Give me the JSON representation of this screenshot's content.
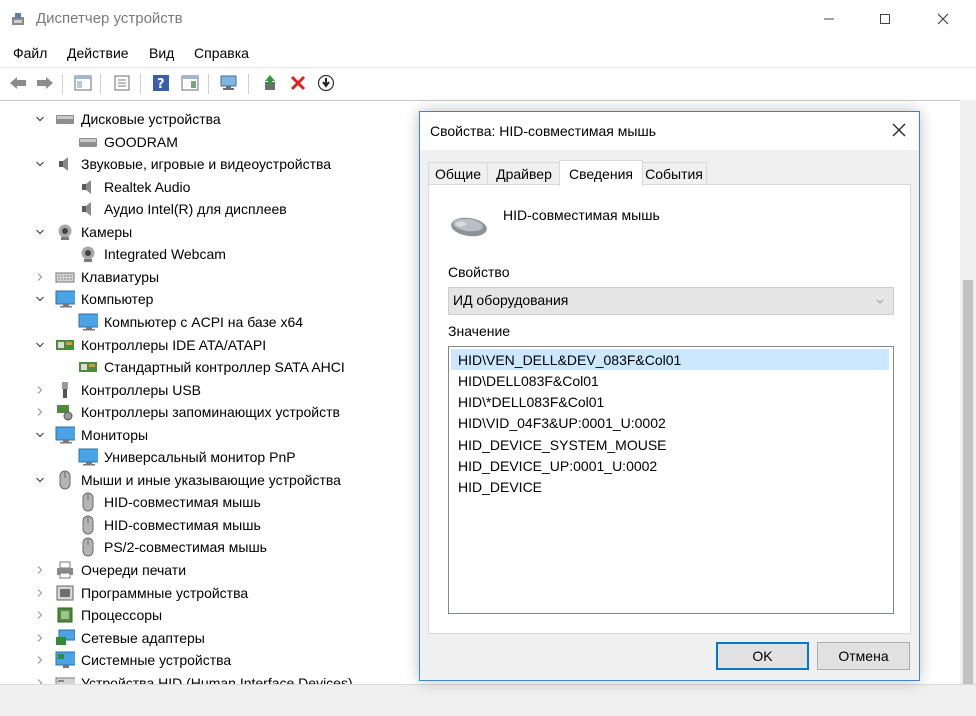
{
  "app": {
    "title": "Диспетчер устройств",
    "minimize_icon": "minimize-icon",
    "maximize_icon": "maximize-icon",
    "close_icon": "close-icon"
  },
  "menu": [
    "Файл",
    "Действие",
    "Вид",
    "Справка"
  ],
  "toolbar": {
    "buttons": [
      "back-arrow-icon",
      "forward-arrow-icon",
      "show-hide-console-tree-icon",
      "properties-icon",
      "help-icon",
      "action-pane-icon",
      "scan-hardware-icon",
      "update-driver-icon",
      "uninstall-device-icon",
      "disable-device-icon"
    ]
  },
  "tree": [
    {
      "label": "Дисковые устройства",
      "expanded": true,
      "icon": "disk-drive-icon"
    },
    {
      "label": "GOODRAM",
      "icon": "disk-drive-icon"
    },
    {
      "label": "Звуковые, игровые и видеоустройства",
      "expanded": true,
      "icon": "speaker-icon"
    },
    {
      "label": "Realtek Audio",
      "icon": "speaker-icon"
    },
    {
      "label": "Аудио Intel(R) для дисплеев",
      "icon": "speaker-icon"
    },
    {
      "label": "Камеры",
      "expanded": true,
      "icon": "webcam-icon"
    },
    {
      "label": "Integrated Webcam",
      "icon": "webcam-icon"
    },
    {
      "label": "Клавиатуры",
      "expanded": false,
      "icon": "keyboard-icon"
    },
    {
      "label": "Компьютер",
      "expanded": true,
      "icon": "monitor-icon"
    },
    {
      "label": "Компьютер с ACPI на базе x64",
      "icon": "monitor-icon"
    },
    {
      "label": "Контроллеры IDE ATA/ATAPI",
      "expanded": true,
      "icon": "ide-controller-icon"
    },
    {
      "label": "Стандартный контроллер SATA AHCI",
      "icon": "ide-controller-icon"
    },
    {
      "label": "Контроллеры USB",
      "expanded": false,
      "icon": "usb-icon"
    },
    {
      "label": "Контроллеры запоминающих устройств",
      "expanded": false,
      "icon": "storage-controller-icon"
    },
    {
      "label": "Мониторы",
      "expanded": true,
      "icon": "monitor-icon"
    },
    {
      "label": "Универсальный монитор PnP",
      "icon": "monitor-icon"
    },
    {
      "label": "Мыши и иные указывающие устройства",
      "expanded": true,
      "icon": "mouse-icon"
    },
    {
      "label": "HID-совместимая мышь",
      "icon": "mouse-icon"
    },
    {
      "label": "HID-совместимая мышь",
      "icon": "mouse-icon"
    },
    {
      "label": "PS/2-совместимая мышь",
      "icon": "mouse-icon"
    },
    {
      "label": "Очереди печати",
      "expanded": false,
      "icon": "printer-icon"
    },
    {
      "label": "Программные устройства",
      "expanded": false,
      "icon": "software-device-icon"
    },
    {
      "label": "Процессоры",
      "expanded": false,
      "icon": "processor-icon"
    },
    {
      "label": "Сетевые адаптеры",
      "expanded": false,
      "icon": "network-adapter-icon"
    },
    {
      "label": "Системные устройства",
      "expanded": false,
      "icon": "system-device-icon"
    },
    {
      "label": "Устройства HID (Human Interface Devices)",
      "expanded": false,
      "icon": "hid-device-icon"
    }
  ],
  "dialog": {
    "title": "Свойства: HID-совместимая мышь",
    "tabs": [
      "Общие",
      "Драйвер",
      "Сведения",
      "События"
    ],
    "active_tab": "Сведения",
    "device_name": "HID-совместимая мышь",
    "property_label": "Свойство",
    "property_value": "ИД оборудования",
    "value_label": "Значение",
    "values": [
      "HID\\VEN_DELL&DEV_083F&Col01",
      "HID\\DELL083F&Col01",
      "HID\\*DELL083F&Col01",
      "HID\\VID_04F3&UP:0001_U:0002",
      "HID_DEVICE_SYSTEM_MOUSE",
      "HID_DEVICE_UP:0001_U:0002",
      "HID_DEVICE"
    ],
    "ok_label": "OK",
    "cancel_label": "Отмена"
  }
}
